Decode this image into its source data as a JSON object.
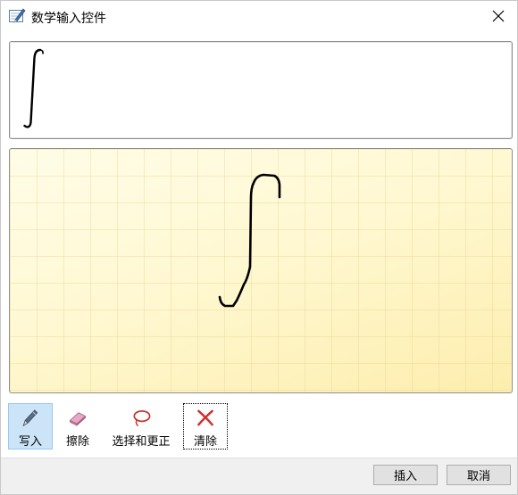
{
  "window": {
    "title": "数学输入控件",
    "app_icon": "math-input-icon",
    "close_icon": "close-icon"
  },
  "preview": {
    "content": "integral-symbol"
  },
  "pad": {
    "content": "handwritten-integral-stroke"
  },
  "toolbar": {
    "write_label": "写入",
    "erase_label": "擦除",
    "select_label": "选择和更正",
    "clear_label": "清除",
    "write_icon": "pen-icon",
    "erase_icon": "eraser-icon",
    "select_icon": "lasso-icon",
    "clear_icon": "red-x-icon",
    "active_tool": "写入"
  },
  "buttons": {
    "insert_label": "插入",
    "cancel_label": "取消"
  },
  "colors": {
    "pad_background": "#fff6c8",
    "active_tool_bg": "#cce4f7",
    "clear_icon": "#d32f2f",
    "ink": "#000000"
  }
}
